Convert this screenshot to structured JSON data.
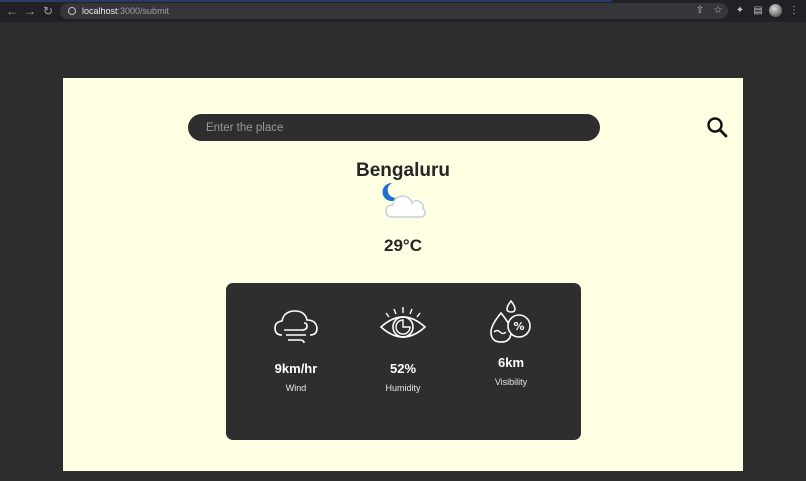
{
  "browser": {
    "url_host": "localhost",
    "url_path": ":3000/submit",
    "icons": [
      "back-icon",
      "forward-icon",
      "reload-icon",
      "info-icon",
      "share-icon",
      "star-icon",
      "extensions-icon",
      "sidepanel-icon",
      "profile-avatar",
      "menu-icon"
    ]
  },
  "search": {
    "placeholder": "Enter the place",
    "value": ""
  },
  "weather": {
    "city": "Bengaluru",
    "condition_icon": "moon-cloud-icon",
    "temperature": "29°C"
  },
  "stats": [
    {
      "value": "9km/hr",
      "label": "Wind",
      "icon": "wind-cloud-icon"
    },
    {
      "value": "52%",
      "label": "Humidity",
      "icon": "eye-icon"
    },
    {
      "value": "6km",
      "label": "Visibility",
      "icon": "humidity-drop-icon"
    }
  ],
  "colors": {
    "page_bg": "#ffffe4",
    "outer_bg": "#2d2d2d",
    "card_bg": "#2e2e2e",
    "moon": "#1f6fd1",
    "cloud": "#cfd6de"
  }
}
